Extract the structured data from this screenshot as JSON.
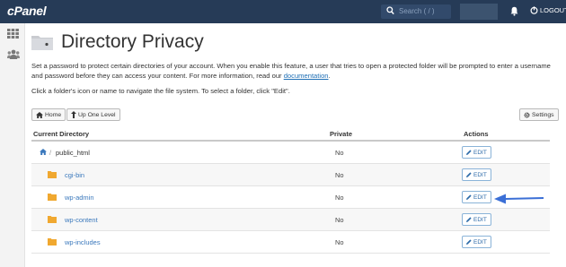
{
  "topbar": {
    "logo": "cPanel",
    "search_placeholder": "Search ( / )",
    "logout_label": "LOGOUT"
  },
  "page": {
    "title": "Directory Privacy",
    "description_1": "Set a password to protect certain directories of your account. When you enable this feature, a user that tries to open a protected folder will be prompted to enter a username and password before they can access your content. For more information, read our ",
    "doc_link": "documentation",
    "description_end": ".",
    "hint": "Click a folder's icon or name to navigate the file system. To select a folder, click \"Edit\"."
  },
  "toolbar": {
    "home_label": "Home",
    "up_label": "Up One Level",
    "settings_label": "Settings"
  },
  "table": {
    "headers": {
      "directory": "Current Directory",
      "private": "Private",
      "actions": "Actions"
    },
    "current": {
      "name": "public_html",
      "private": "No",
      "action": "EDIT"
    },
    "rows": [
      {
        "name": "cgi-bin",
        "private": "No",
        "action": "EDIT"
      },
      {
        "name": "wp-admin",
        "private": "No",
        "action": "EDIT"
      },
      {
        "name": "wp-content",
        "private": "No",
        "action": "EDIT"
      },
      {
        "name": "wp-includes",
        "private": "No",
        "action": "EDIT"
      }
    ]
  },
  "colors": {
    "topbar": "#263b57",
    "folder": "#f0a830",
    "link": "#3a78bc",
    "arrow": "#3b6fd6"
  },
  "icons": {
    "search": "search-icon",
    "bell": "bell-icon",
    "logout": "logout-icon",
    "apps": "grid-icon",
    "users": "users-icon",
    "home": "home-icon",
    "up": "level-up-icon",
    "settings": "gear-icon",
    "edit": "pencil-icon",
    "folder": "folder-icon"
  }
}
